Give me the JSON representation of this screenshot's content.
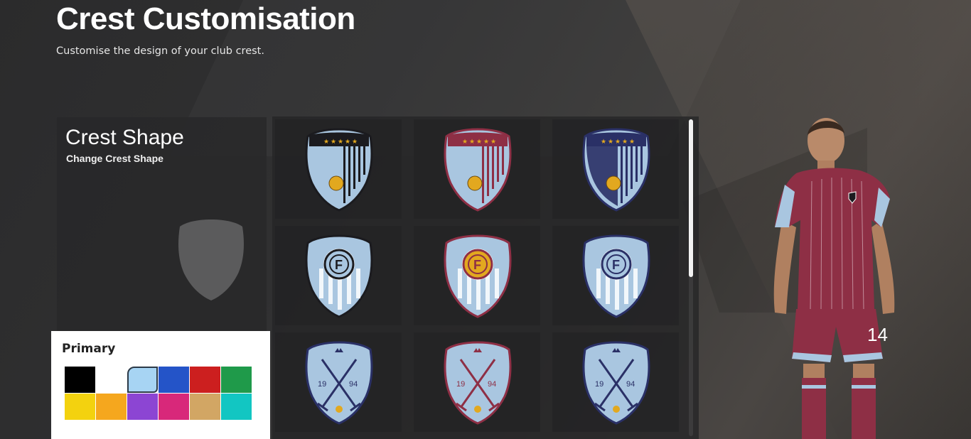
{
  "header": {
    "title": "Crest Customisation",
    "subtitle": "Customise the design of your club crest."
  },
  "crest_shape": {
    "title": "Crest Shape",
    "subtitle": "Change Crest Shape"
  },
  "color_picker": {
    "label": "Primary",
    "swatches": [
      "#000000",
      "#ffffff",
      "#a7d4f3",
      "#2454c8",
      "#cc1f1f",
      "#1f9a4a",
      "#f3d20f",
      "#f5a71e",
      "#8c45d3",
      "#d8287a",
      "#d2a664",
      "#12c6c2"
    ],
    "selected_index": 2
  },
  "crests": [
    {
      "name": "crest-stars-stripes-black"
    },
    {
      "name": "crest-stars-stripes-red"
    },
    {
      "name": "crest-stars-stripes-navy"
    },
    {
      "name": "crest-roundel-f-black"
    },
    {
      "name": "crest-roundel-f-orange"
    },
    {
      "name": "crest-roundel-f-navy"
    },
    {
      "name": "crest-swords-1994-navy"
    },
    {
      "name": "crest-swords-1994-red"
    },
    {
      "name": "crest-swords-1994-navy-2"
    }
  ],
  "crest_year_left": "19",
  "crest_year_right": "94",
  "crest_letter": "F",
  "player": {
    "number": "14"
  },
  "colors": {
    "light_blue": "#a9c6e0",
    "maroon": "#8e2f45",
    "navy": "#2a3066",
    "black": "#1b1b1f",
    "ball": "#e2a81f"
  }
}
